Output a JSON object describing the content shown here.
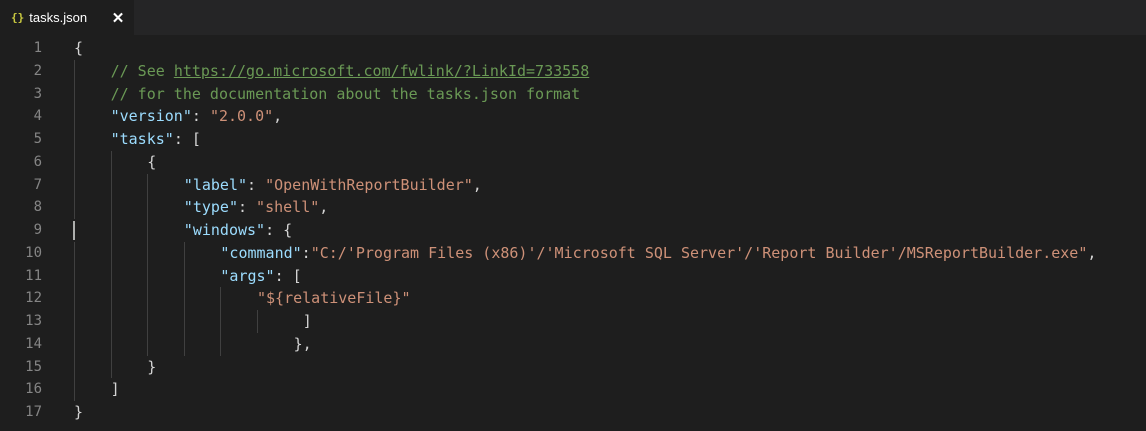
{
  "tab": {
    "icon_text": "{}",
    "title": "tasks.json",
    "close_glyph": "✕"
  },
  "lines": [
    {
      "n": "1",
      "indent": 0,
      "guides": [],
      "tokens": [
        {
          "t": "{",
          "c": "p"
        }
      ]
    },
    {
      "n": "2",
      "indent": 1,
      "guides": [
        0
      ],
      "tokens": [
        {
          "t": "// See ",
          "c": "c"
        },
        {
          "t": "https://go.microsoft.com/fwlink/?LinkId=733558",
          "c": "u"
        }
      ]
    },
    {
      "n": "3",
      "indent": 1,
      "guides": [
        0
      ],
      "tokens": [
        {
          "t": "// for the documentation about the tasks.json format",
          "c": "c"
        }
      ]
    },
    {
      "n": "4",
      "indent": 1,
      "guides": [
        0
      ],
      "tokens": [
        {
          "t": "\"version\"",
          "c": "k"
        },
        {
          "t": ": ",
          "c": "p"
        },
        {
          "t": "\"2.0.0\"",
          "c": "s"
        },
        {
          "t": ",",
          "c": "p"
        }
      ]
    },
    {
      "n": "5",
      "indent": 1,
      "guides": [
        0
      ],
      "tokens": [
        {
          "t": "\"tasks\"",
          "c": "k"
        },
        {
          "t": ": [",
          "c": "p"
        }
      ]
    },
    {
      "n": "6",
      "indent": 2,
      "guides": [
        0,
        1
      ],
      "tokens": [
        {
          "t": "{",
          "c": "p"
        }
      ]
    },
    {
      "n": "7",
      "indent": 3,
      "guides": [
        0,
        1,
        2
      ],
      "tokens": [
        {
          "t": "\"label\"",
          "c": "k"
        },
        {
          "t": ": ",
          "c": "p"
        },
        {
          "t": "\"OpenWithReportBuilder\"",
          "c": "s"
        },
        {
          "t": ",",
          "c": "p"
        }
      ]
    },
    {
      "n": "8",
      "indent": 3,
      "guides": [
        0,
        1,
        2
      ],
      "tokens": [
        {
          "t": "\"type\"",
          "c": "k"
        },
        {
          "t": ": ",
          "c": "p"
        },
        {
          "t": "\"shell\"",
          "c": "s"
        },
        {
          "t": ",",
          "c": "p"
        }
      ]
    },
    {
      "n": "9",
      "indent": 3,
      "guides": [
        1,
        2
      ],
      "cursor": true,
      "tokens": [
        {
          "t": "\"windows\"",
          "c": "k"
        },
        {
          "t": ": {",
          "c": "p"
        }
      ]
    },
    {
      "n": "10",
      "indent": 4,
      "guides": [
        0,
        1,
        2,
        3
      ],
      "tokens": [
        {
          "t": "\"command\"",
          "c": "k"
        },
        {
          "t": ":",
          "c": "p"
        },
        {
          "t": "\"C:/'Program Files (x86)'/'Microsoft SQL Server'/'Report Builder'/MSReportBuilder.exe\"",
          "c": "s"
        },
        {
          "t": ",",
          "c": "p"
        }
      ]
    },
    {
      "n": "11",
      "indent": 4,
      "guides": [
        0,
        1,
        2,
        3
      ],
      "tokens": [
        {
          "t": "\"args\"",
          "c": "k"
        },
        {
          "t": ": [",
          "c": "p"
        }
      ]
    },
    {
      "n": "12",
      "indent": 5,
      "guides": [
        0,
        1,
        2,
        3,
        4
      ],
      "tokens": [
        {
          "t": "\"${relativeFile}\"",
          "c": "s"
        }
      ]
    },
    {
      "n": "13",
      "indent": 6,
      "offset": 1,
      "guides": [
        0,
        1,
        2,
        3,
        4,
        5
      ],
      "tokens": [
        {
          "t": "]",
          "c": "p"
        }
      ]
    },
    {
      "n": "14",
      "indent": 6,
      "guides": [
        0,
        1,
        2,
        3,
        4
      ],
      "tokens": [
        {
          "t": "},",
          "c": "p"
        }
      ]
    },
    {
      "n": "15",
      "indent": 2,
      "guides": [
        0,
        1
      ],
      "tokens": [
        {
          "t": "}",
          "c": "p"
        }
      ]
    },
    {
      "n": "16",
      "indent": 1,
      "guides": [
        0
      ],
      "tokens": [
        {
          "t": "]",
          "c": "p"
        }
      ]
    },
    {
      "n": "17",
      "indent": 0,
      "guides": [],
      "tokens": [
        {
          "t": "}",
          "c": "p"
        }
      ]
    }
  ]
}
